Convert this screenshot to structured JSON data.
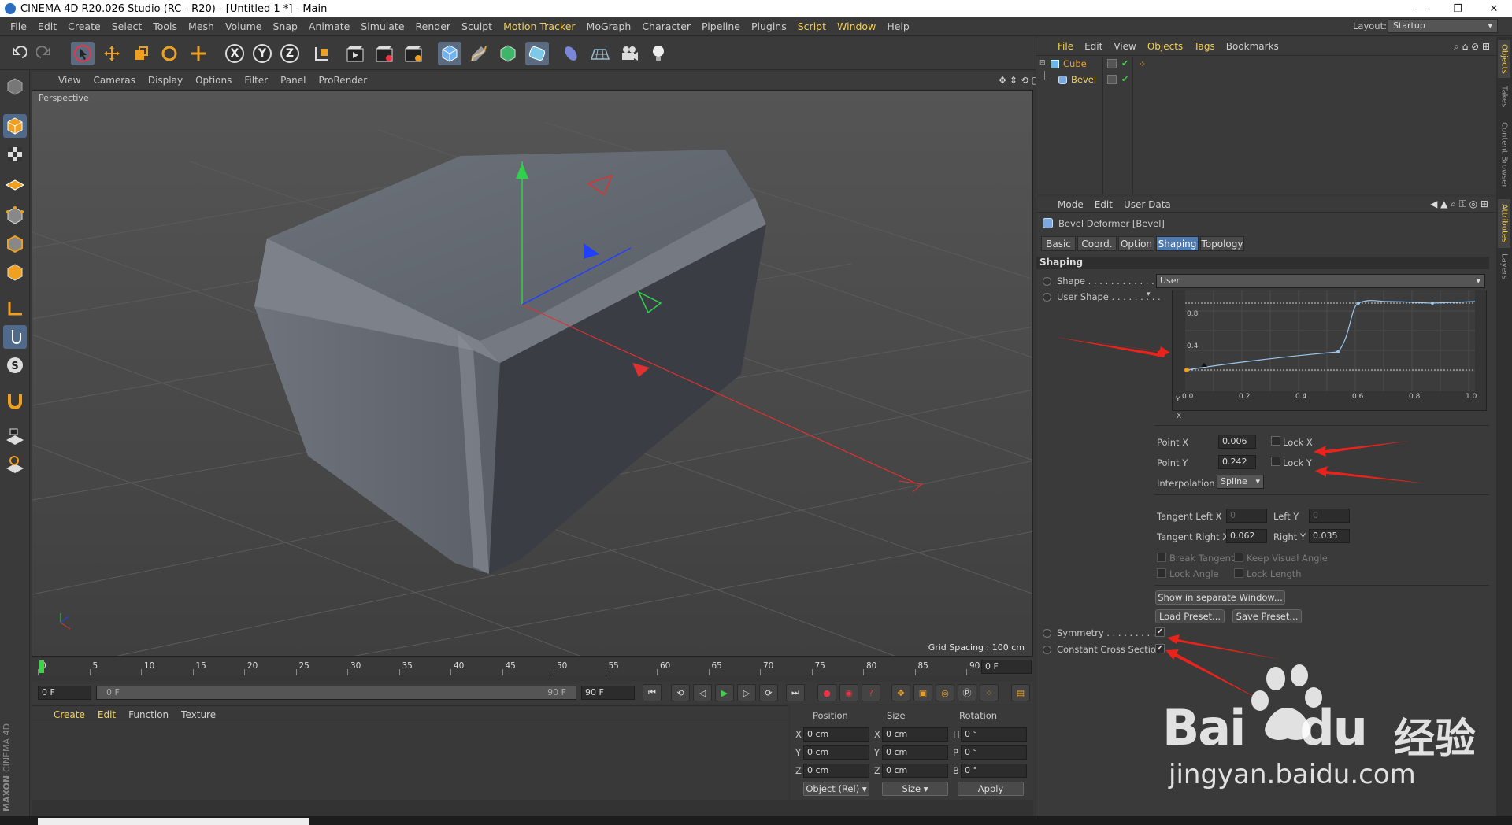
{
  "titlebar": {
    "title": "CINEMA 4D R20.026 Studio (RC - R20) - [Untitled 1 *] - Main",
    "minimize": "—",
    "restore": "❐",
    "close": "✕"
  },
  "menubar": {
    "items": [
      "File",
      "Edit",
      "Create",
      "Select",
      "Tools",
      "Mesh",
      "Volume",
      "Snap",
      "Animate",
      "Simulate",
      "Render",
      "Sculpt",
      "Motion Tracker",
      "MoGraph",
      "Character",
      "Pipeline",
      "Plugins",
      "Script",
      "Window",
      "Help"
    ],
    "highlighted": [
      "Motion Tracker",
      "Script",
      "Window"
    ],
    "layout_label": "Layout:",
    "layout_value": "Startup"
  },
  "toolbar": {
    "axis_x": "X",
    "axis_y": "Y",
    "axis_z": "Z"
  },
  "viewport": {
    "menu": [
      "View",
      "Cameras",
      "Display",
      "Options",
      "Filter",
      "Panel",
      "ProRender"
    ],
    "camera_label": "Perspective",
    "grid_spacing": "Grid Spacing : 100 cm"
  },
  "timeline": {
    "ticks": [
      "0",
      "5",
      "10",
      "15",
      "20",
      "25",
      "30",
      "35",
      "40",
      "45",
      "50",
      "55",
      "60",
      "65",
      "70",
      "75",
      "80",
      "85",
      "90"
    ],
    "end_frame": "0 F"
  },
  "timecontrols": {
    "current": "0 F",
    "range_start": "0 F",
    "range_end": "90 F",
    "max": "90 F"
  },
  "material_manager": {
    "menu": [
      "Create",
      "Edit",
      "Function",
      "Texture"
    ]
  },
  "coordinates": {
    "headers": [
      "Position",
      "Size",
      "Rotation"
    ],
    "rows": [
      {
        "axis": "X",
        "pos": "0 cm",
        "saxis": "X",
        "size": "0 cm",
        "raxis": "H",
        "rot": "0 °"
      },
      {
        "axis": "Y",
        "pos": "0 cm",
        "saxis": "Y",
        "size": "0 cm",
        "raxis": "P",
        "rot": "0 °"
      },
      {
        "axis": "Z",
        "pos": "0 cm",
        "saxis": "Z",
        "size": "0 cm",
        "raxis": "B",
        "rot": "0 °"
      }
    ],
    "mode": "Object (Rel)",
    "size_mode": "Size",
    "apply": "Apply"
  },
  "object_manager": {
    "menu": [
      "File",
      "Edit",
      "View",
      "Objects",
      "Tags",
      "Bookmarks"
    ],
    "objects": [
      {
        "name": "Cube"
      },
      {
        "name": "Bevel"
      }
    ]
  },
  "attributes": {
    "menu": [
      "Mode",
      "Edit",
      "User Data"
    ],
    "object_title": "Bevel Deformer [Bevel]",
    "tabs": [
      "Basic",
      "Coord.",
      "Option",
      "Shaping",
      "Topology"
    ],
    "active_tab": "Shaping",
    "section": "Shaping",
    "shape_label": "Shape . . . . . . . . . . . .",
    "shape_value": "User",
    "user_shape_label": "User Shape . . . . . . . . .",
    "graph": {
      "x_label": "X",
      "y_label": "Y",
      "x_ticks": [
        "0.0",
        "0.2",
        "0.4",
        "0.6",
        "0.8",
        "1.0"
      ],
      "y_ticks": [
        "0.4",
        "0.8"
      ]
    },
    "point_x_label": "Point X",
    "point_x": "0.006",
    "lock_x": "Lock X",
    "point_y_label": "Point Y",
    "point_y": "0.242",
    "lock_y": "Lock Y",
    "interpolation_label": "Interpolation",
    "interpolation": "Spline",
    "tangent_left_x_label": "Tangent Left X",
    "tangent_left_x": "0",
    "left_y_label": "Left Y",
    "left_y": "0",
    "tangent_right_x_label": "Tangent Right X",
    "tangent_right_x": "0.062",
    "right_y_label": "Right Y",
    "right_y": "0.035",
    "break_tangent": "Break Tangent",
    "keep_visual_angle": "Keep Visual Angle",
    "lock_angle": "Lock Angle",
    "lock_length": "Lock Length",
    "show_window": "Show in separate Window...",
    "load_preset": "Load Preset...",
    "save_preset": "Save Preset...",
    "symmetry": "Symmetry . . . . . . . . . .",
    "symmetry_checked": "✔",
    "constant_cross": "Constant Cross Section",
    "constant_cross_checked": "✔"
  },
  "sidetabs": [
    "Objects",
    "Takes",
    "Content Browser",
    "Attributes",
    "Layers"
  ],
  "watermark": {
    "brand": "Bai",
    "brand2": "du",
    "chinese": "经验",
    "url": "jingyan.baidu.com"
  },
  "branding": {
    "maxon": "MAXON",
    "c4d": "CINEMA 4D"
  },
  "colors": {
    "accent": "#4f7bb3",
    "highlight": "#f2d05a",
    "arrow": "#e8231c"
  }
}
